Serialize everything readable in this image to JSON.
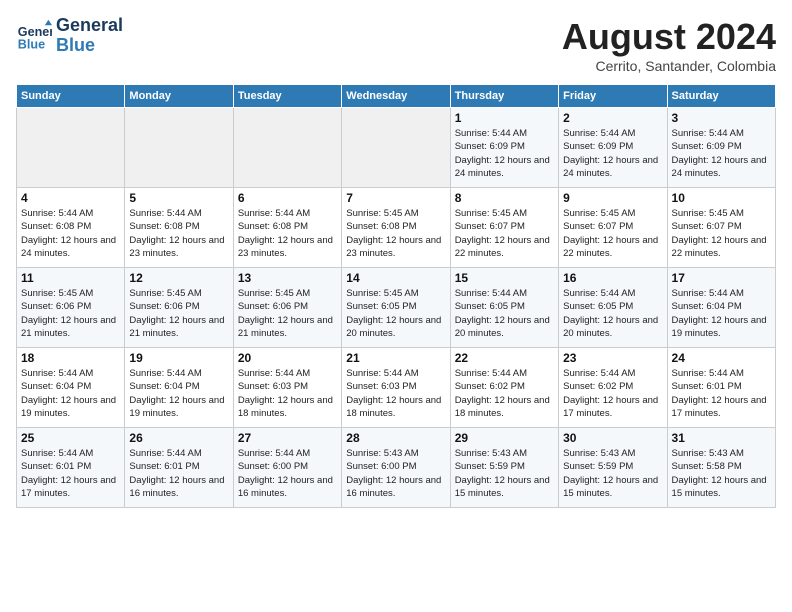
{
  "header": {
    "logo_line1": "General",
    "logo_line2": "Blue",
    "title": "August 2024",
    "subtitle": "Cerrito, Santander, Colombia"
  },
  "days_of_week": [
    "Sunday",
    "Monday",
    "Tuesday",
    "Wednesday",
    "Thursday",
    "Friday",
    "Saturday"
  ],
  "weeks": [
    [
      {
        "day": "",
        "info": ""
      },
      {
        "day": "",
        "info": ""
      },
      {
        "day": "",
        "info": ""
      },
      {
        "day": "",
        "info": ""
      },
      {
        "day": "1",
        "info": "Sunrise: 5:44 AM\nSunset: 6:09 PM\nDaylight: 12 hours\nand 24 minutes."
      },
      {
        "day": "2",
        "info": "Sunrise: 5:44 AM\nSunset: 6:09 PM\nDaylight: 12 hours\nand 24 minutes."
      },
      {
        "day": "3",
        "info": "Sunrise: 5:44 AM\nSunset: 6:09 PM\nDaylight: 12 hours\nand 24 minutes."
      }
    ],
    [
      {
        "day": "4",
        "info": "Sunrise: 5:44 AM\nSunset: 6:08 PM\nDaylight: 12 hours\nand 24 minutes."
      },
      {
        "day": "5",
        "info": "Sunrise: 5:44 AM\nSunset: 6:08 PM\nDaylight: 12 hours\nand 23 minutes."
      },
      {
        "day": "6",
        "info": "Sunrise: 5:44 AM\nSunset: 6:08 PM\nDaylight: 12 hours\nand 23 minutes."
      },
      {
        "day": "7",
        "info": "Sunrise: 5:45 AM\nSunset: 6:08 PM\nDaylight: 12 hours\nand 23 minutes."
      },
      {
        "day": "8",
        "info": "Sunrise: 5:45 AM\nSunset: 6:07 PM\nDaylight: 12 hours\nand 22 minutes."
      },
      {
        "day": "9",
        "info": "Sunrise: 5:45 AM\nSunset: 6:07 PM\nDaylight: 12 hours\nand 22 minutes."
      },
      {
        "day": "10",
        "info": "Sunrise: 5:45 AM\nSunset: 6:07 PM\nDaylight: 12 hours\nand 22 minutes."
      }
    ],
    [
      {
        "day": "11",
        "info": "Sunrise: 5:45 AM\nSunset: 6:06 PM\nDaylight: 12 hours\nand 21 minutes."
      },
      {
        "day": "12",
        "info": "Sunrise: 5:45 AM\nSunset: 6:06 PM\nDaylight: 12 hours\nand 21 minutes."
      },
      {
        "day": "13",
        "info": "Sunrise: 5:45 AM\nSunset: 6:06 PM\nDaylight: 12 hours\nand 21 minutes."
      },
      {
        "day": "14",
        "info": "Sunrise: 5:45 AM\nSunset: 6:05 PM\nDaylight: 12 hours\nand 20 minutes."
      },
      {
        "day": "15",
        "info": "Sunrise: 5:44 AM\nSunset: 6:05 PM\nDaylight: 12 hours\nand 20 minutes."
      },
      {
        "day": "16",
        "info": "Sunrise: 5:44 AM\nSunset: 6:05 PM\nDaylight: 12 hours\nand 20 minutes."
      },
      {
        "day": "17",
        "info": "Sunrise: 5:44 AM\nSunset: 6:04 PM\nDaylight: 12 hours\nand 19 minutes."
      }
    ],
    [
      {
        "day": "18",
        "info": "Sunrise: 5:44 AM\nSunset: 6:04 PM\nDaylight: 12 hours\nand 19 minutes."
      },
      {
        "day": "19",
        "info": "Sunrise: 5:44 AM\nSunset: 6:04 PM\nDaylight: 12 hours\nand 19 minutes."
      },
      {
        "day": "20",
        "info": "Sunrise: 5:44 AM\nSunset: 6:03 PM\nDaylight: 12 hours\nand 18 minutes."
      },
      {
        "day": "21",
        "info": "Sunrise: 5:44 AM\nSunset: 6:03 PM\nDaylight: 12 hours\nand 18 minutes."
      },
      {
        "day": "22",
        "info": "Sunrise: 5:44 AM\nSunset: 6:02 PM\nDaylight: 12 hours\nand 18 minutes."
      },
      {
        "day": "23",
        "info": "Sunrise: 5:44 AM\nSunset: 6:02 PM\nDaylight: 12 hours\nand 17 minutes."
      },
      {
        "day": "24",
        "info": "Sunrise: 5:44 AM\nSunset: 6:01 PM\nDaylight: 12 hours\nand 17 minutes."
      }
    ],
    [
      {
        "day": "25",
        "info": "Sunrise: 5:44 AM\nSunset: 6:01 PM\nDaylight: 12 hours\nand 17 minutes."
      },
      {
        "day": "26",
        "info": "Sunrise: 5:44 AM\nSunset: 6:01 PM\nDaylight: 12 hours\nand 16 minutes."
      },
      {
        "day": "27",
        "info": "Sunrise: 5:44 AM\nSunset: 6:00 PM\nDaylight: 12 hours\nand 16 minutes."
      },
      {
        "day": "28",
        "info": "Sunrise: 5:43 AM\nSunset: 6:00 PM\nDaylight: 12 hours\nand 16 minutes."
      },
      {
        "day": "29",
        "info": "Sunrise: 5:43 AM\nSunset: 5:59 PM\nDaylight: 12 hours\nand 15 minutes."
      },
      {
        "day": "30",
        "info": "Sunrise: 5:43 AM\nSunset: 5:59 PM\nDaylight: 12 hours\nand 15 minutes."
      },
      {
        "day": "31",
        "info": "Sunrise: 5:43 AM\nSunset: 5:58 PM\nDaylight: 12 hours\nand 15 minutes."
      }
    ]
  ]
}
